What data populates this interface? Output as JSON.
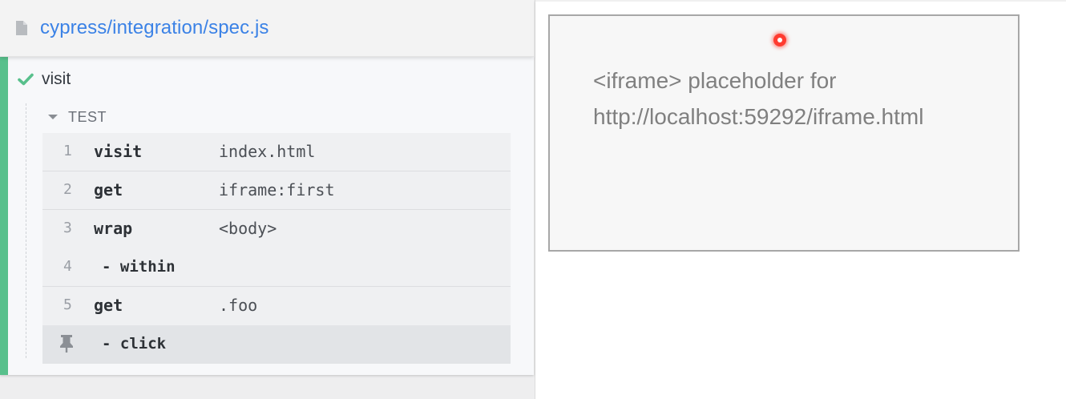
{
  "reporter": {
    "spec_path": "cypress/integration/spec.js",
    "test_title": "visit",
    "section_label": "TEST",
    "commands": [
      {
        "num": "1",
        "name": "visit",
        "message": "index.html"
      },
      {
        "num": "2",
        "name": "get",
        "message": "iframe:first"
      },
      {
        "num": "3",
        "name": "wrap",
        "message": "<body>"
      },
      {
        "num": "4",
        "name": "- within",
        "message": ""
      },
      {
        "num": "5",
        "name": "get",
        "message": ".foo"
      },
      {
        "num": "",
        "name": "- click",
        "message": ""
      }
    ]
  },
  "aut": {
    "iframe_placeholder_line1": "<iframe> placeholder for",
    "iframe_placeholder_line2": "http://localhost:59292/iframe.html"
  },
  "colors": {
    "passed_bar": "#58c08c",
    "spec_link": "#3b82e6",
    "click_indicator": "#ff3b30"
  },
  "icons": {
    "file": "file-icon",
    "passed": "check-icon",
    "collapse": "caret-down-icon",
    "pinned": "pin-icon"
  }
}
